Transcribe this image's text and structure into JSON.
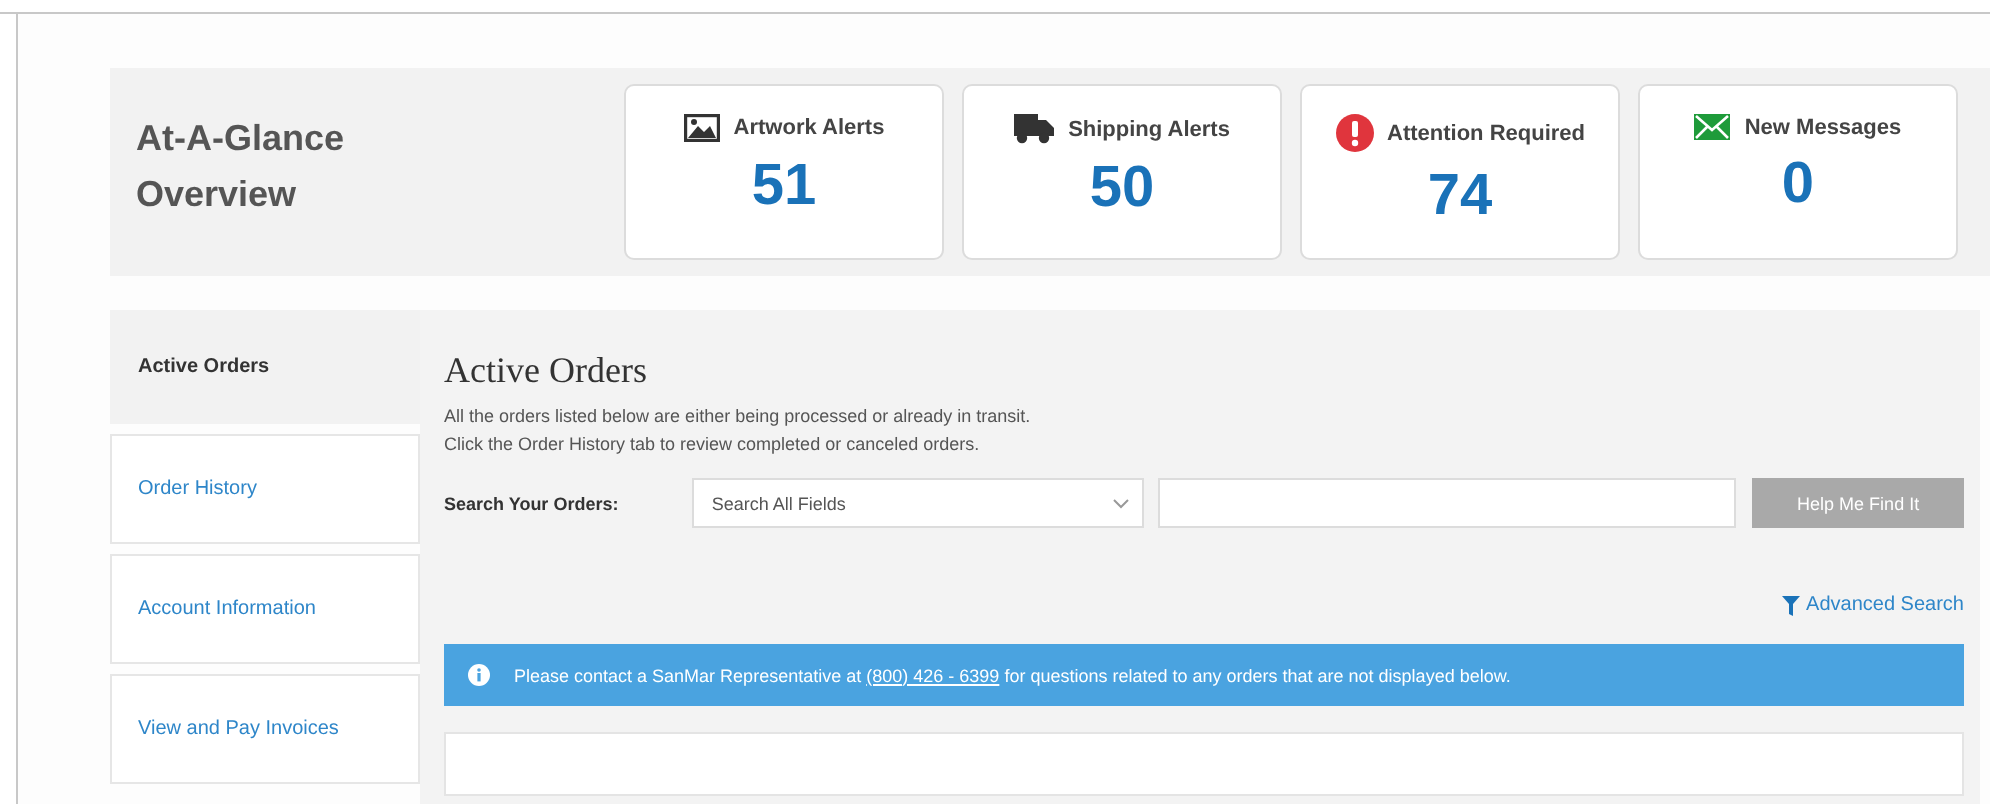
{
  "overview": {
    "title_lines": [
      "At-A-Glance",
      "Overview"
    ],
    "cards": [
      {
        "kind": "artwork",
        "label": "Artwork Alerts",
        "count": "51"
      },
      {
        "kind": "shipping",
        "label": "Shipping Alerts",
        "count": "50"
      },
      {
        "kind": "attention",
        "label": "Attention Required",
        "count": "74"
      },
      {
        "kind": "messages",
        "label": "New Messages",
        "count": "0"
      }
    ]
  },
  "sidebar": {
    "items": [
      {
        "label": "Active Orders",
        "selected": true
      },
      {
        "label": "Order History",
        "selected": false
      },
      {
        "label": "Account Information",
        "selected": false
      },
      {
        "label": "View and Pay Invoices",
        "selected": false
      }
    ]
  },
  "main": {
    "title": "Active Orders",
    "description": [
      "All the orders listed below are either being processed or already in transit.",
      "Click the Order History tab to review completed or canceled orders."
    ],
    "search": {
      "label": "Search Your Orders:",
      "select_value": "Search All Fields",
      "button": "Help Me Find It",
      "button_disabled": true
    },
    "advanced_search": "Advanced Search",
    "banner": {
      "before": "Please contact a SanMar Representative at",
      "phone": "(800) 426 - 6399",
      "after": "for questions related to any orders that are not displayed below."
    }
  }
}
